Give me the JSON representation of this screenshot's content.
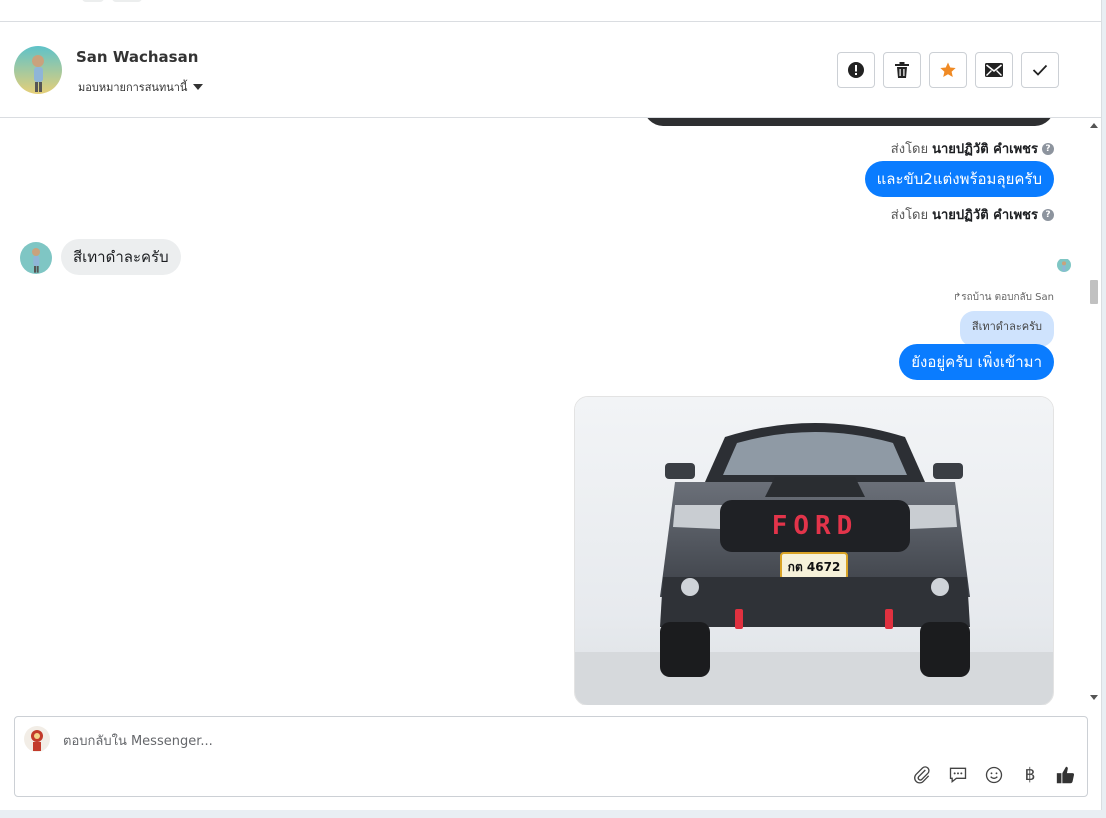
{
  "header": {
    "contact_name": "San Wachasan",
    "assign_label": "มอบหมายการสนทนานี้",
    "actions": [
      {
        "name": "report-button",
        "icon": "exclamation-icon"
      },
      {
        "name": "delete-button",
        "icon": "trash-icon"
      },
      {
        "name": "star-button",
        "icon": "star-icon",
        "color": "#f08a24"
      },
      {
        "name": "mark-unread-button",
        "icon": "envelope-icon"
      },
      {
        "name": "mark-done-button",
        "icon": "check-icon"
      }
    ]
  },
  "messages": {
    "sent_by_prefix": "ส่งโดย",
    "sender_name": "นายปฏิวัติ คำเพชร",
    "outgoing_1": "และขับ2แต่งพร้อมลุยครับ",
    "incoming_1": "สีเทาดำละครับ",
    "reply_context": "รถบ้าน ตอบกลับ San",
    "quoted_text": "สีเทาดำละครับ",
    "outgoing_2": "ยังอยู่ครับ เพิ่งเข้ามา",
    "photo_plate": "กต 4672",
    "photo_brand": "FORD"
  },
  "composer": {
    "placeholder": "ตอบกลับใน Messenger...",
    "value": "",
    "tools": [
      "attach-icon",
      "saved-reply-icon",
      "emoji-icon",
      "baht-icon",
      "like-icon"
    ],
    "baht_symbol": "฿"
  },
  "colors": {
    "bubble_outgoing": "#0a7cff",
    "bubble_incoming": "#eceeef",
    "quoted_bubble": "#cfe3fd",
    "star": "#f08a24"
  }
}
